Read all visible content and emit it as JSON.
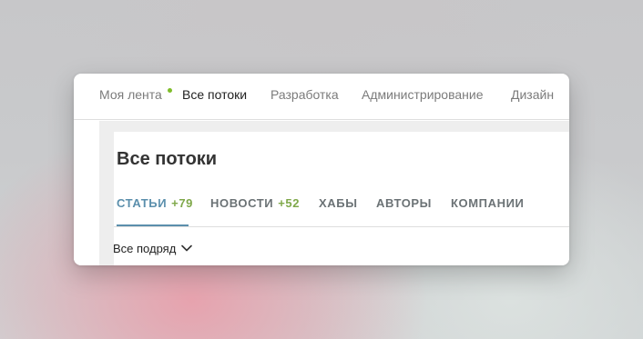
{
  "topnav": {
    "items": [
      {
        "label": "Моя лента",
        "has_dot": true
      },
      {
        "label": "Все потоки",
        "active": true
      },
      {
        "label": "Разработка"
      },
      {
        "label": "Администрирование"
      },
      {
        "label": "Дизайн"
      }
    ],
    "dot_color": "#7fbd2a"
  },
  "page": {
    "title": "Все потоки"
  },
  "tabs": [
    {
      "label": "СТАТЬИ",
      "count": "+79",
      "active": true
    },
    {
      "label": "НОВОСТИ",
      "count": "+52"
    },
    {
      "label": "ХАБЫ"
    },
    {
      "label": "АВТОРЫ"
    },
    {
      "label": "КОМПАНИИ"
    }
  ],
  "filter": {
    "label": "Все подряд",
    "icon": "chevron-down-icon"
  },
  "colors": {
    "accent": "#5b8fac",
    "count_green": "#7fa84a"
  }
}
